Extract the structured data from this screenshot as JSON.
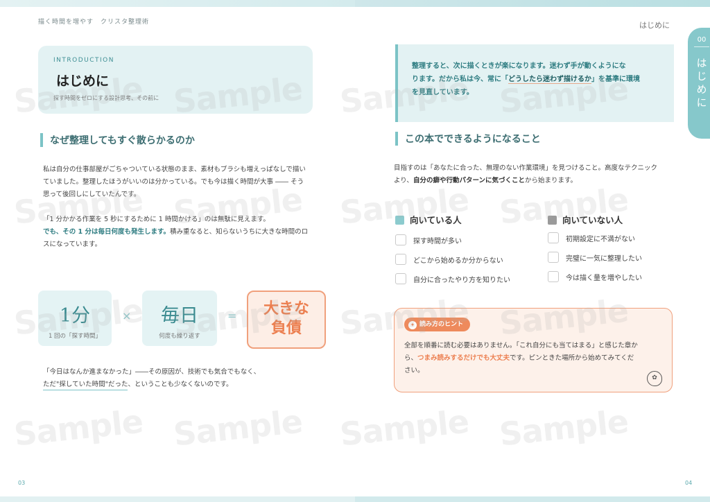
{
  "header": {
    "book_title": "描く時間を増やす　クリスタ整理術",
    "section_right": "はじめに"
  },
  "side_tab": {
    "number": "00",
    "label": "はじめに"
  },
  "intro": {
    "eyebrow": "INTRODUCTION",
    "title": "はじめに",
    "subtitle": "探す時間をゼロにする設計思考、その前に"
  },
  "left": {
    "heading": "なぜ整理してもすぐ散らかるのか",
    "para1": [
      "私は自分の仕事部屋がごちゃついている状態のまま、素材もブラシも増えっぱなしで描い",
      "ていました。整理したほうがいいのは分かっている。でも今は描く時間が大事 ―― そう",
      "思って後回しにしていたんです。"
    ],
    "para2_line1": "「1 分かかる作業を 5 秒にするために 1 時間かける」のは無駄に見えます。",
    "para2_emph": "でも、その 1 分は毎日何度も発生します。",
    "para2_rest1": "積み重なると、知らないうちに大きな時間のロ",
    "para2_rest2": "スになっています。",
    "equation": {
      "term1": "1分",
      "term1_caption": "1 回の「探す時間」",
      "op1": "×",
      "term2": "毎日",
      "term2_caption": "何度も繰り返す",
      "op2": "=",
      "result_line1": "大きな",
      "result_line2": "負債"
    },
    "closing_line1": "「今日はなんか進まなかった」――その原因が、技術でも気合でもなく、",
    "closing_line2_ul": "ただ\"探していた時間\"だった",
    "closing_line2_rest": "、ということも少なくないのです。"
  },
  "right": {
    "quote_line1": "整理すると、次に描くときが楽になります。迷わず手が動くようにな",
    "quote_line2_a": "ります。だから私は今、常に「",
    "quote_line2_hl": "どうしたら迷わず描けるか",
    "quote_line2_b": "」を基準に環境",
    "quote_line3": "を見直しています。",
    "heading": "この本でできるようになること",
    "goal_line1": "目指すのは「あなたに合った、無理のない作業環境」を見つけること。高度なテクニック",
    "goal_line2_a": "より、",
    "goal_line2_emph": "自分の癖や行動パターンに気づくこと",
    "goal_line2_b": "から始まります。",
    "suited": {
      "title": "向いている人",
      "items": [
        "探す時間が多い",
        "どこから始めるか分からない",
        "自分に合ったやり方を知りたい"
      ]
    },
    "not_suited": {
      "title": "向いていない人",
      "items": [
        "初期設定に不満がない",
        "完璧に一気に整理したい",
        "今は描く量を増やしたい"
      ]
    },
    "tip": {
      "badge": "読み方のヒント",
      "line1": "全部を順番に読む必要はありません。「これ自分にも当てはまる」と感じた章か",
      "line2_a": "ら、",
      "line2_hl": "つまみ読みするだけでも大丈夫",
      "line2_b": "です。ピンときた場所から始めてみてくだ",
      "line3": "さい。"
    }
  },
  "footer": {
    "page_left": "03",
    "page_right": "04"
  },
  "watermark": "Sample",
  "colors": {
    "teal": "#7cc3c6",
    "teal_dark": "#2f7d82",
    "orange": "#ee8a5c",
    "box_bg": "#e3f2f3"
  }
}
